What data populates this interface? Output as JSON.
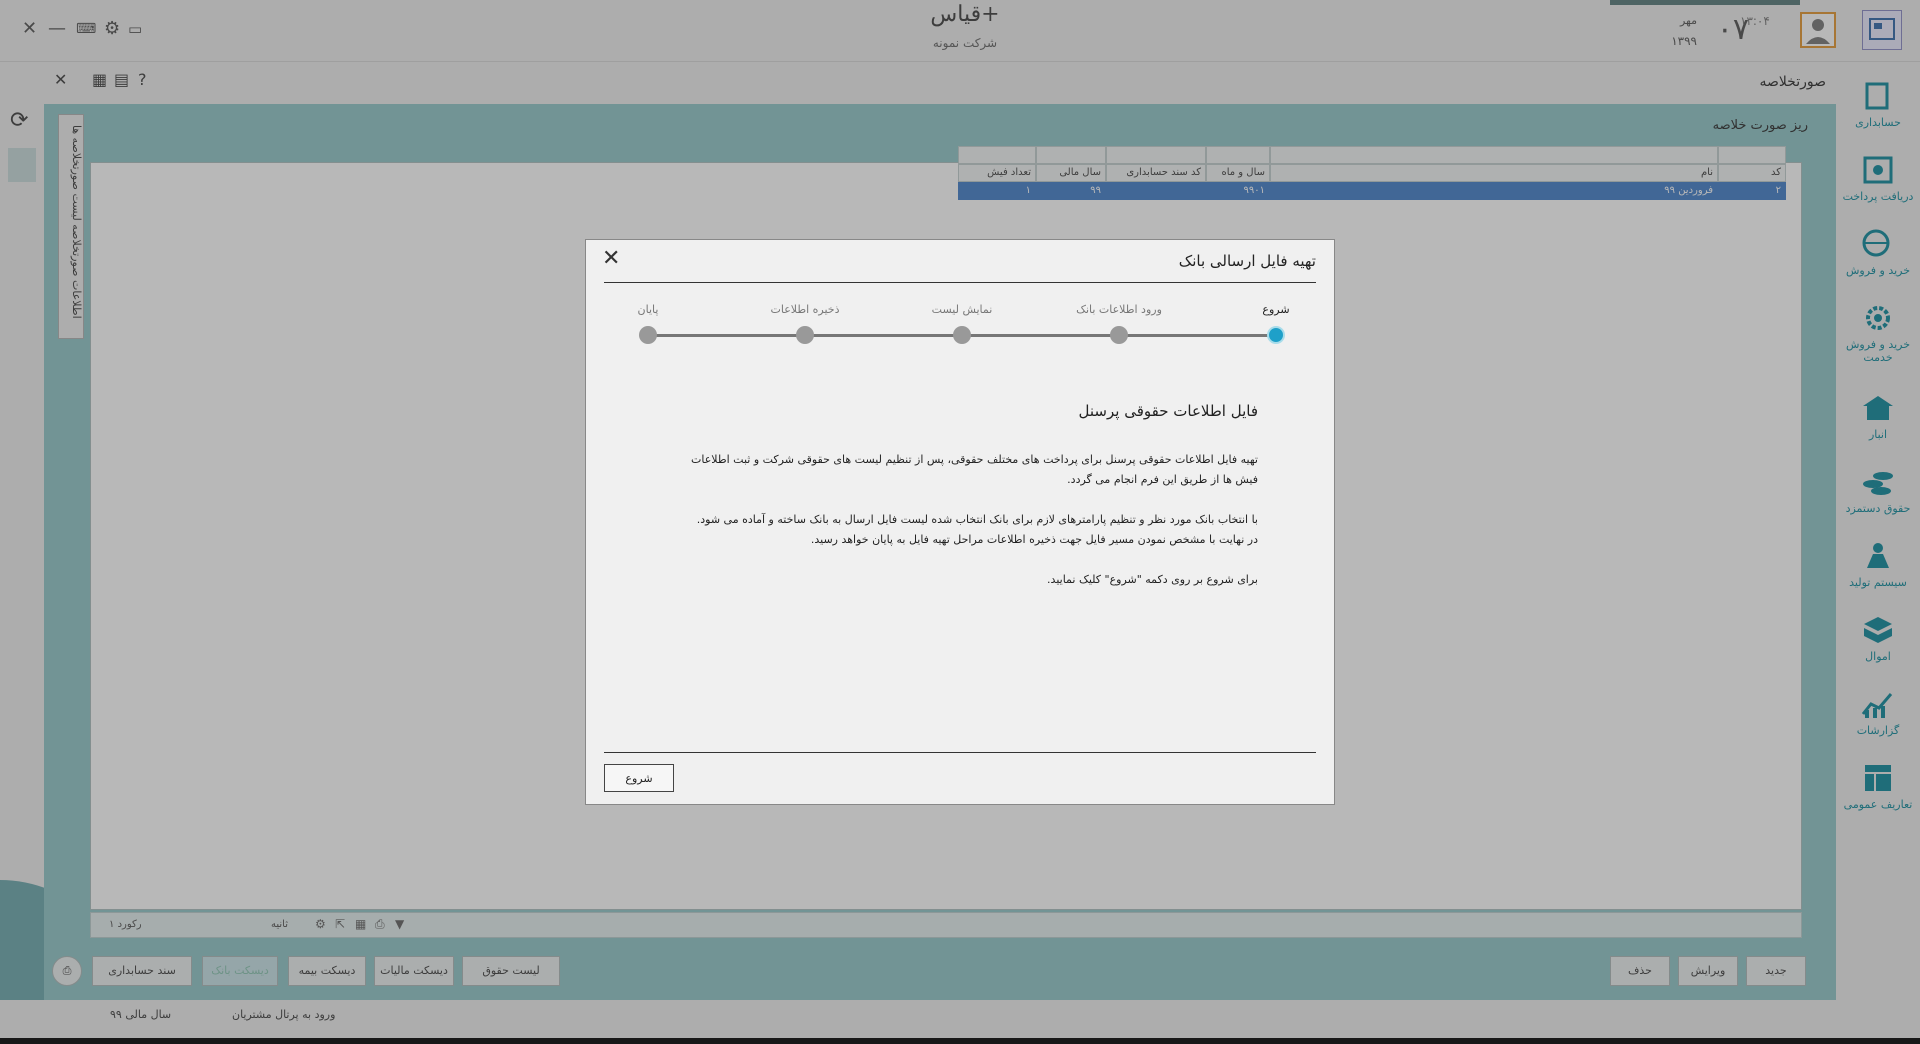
{
  "app": {
    "name": "قیاس+",
    "company": "شرکت نمونه"
  },
  "date": {
    "day": "۰۷",
    "month": "مهر",
    "year": "۱۳۹۹",
    "time": "۱۳:۰۴"
  },
  "form": {
    "title": "صورتخلاصه",
    "subtitle": "ریز صورت خلاصه",
    "vertical_tab": "اطلاعات صورتخلاصه   لیست صورتخلاصه ها"
  },
  "grid": {
    "headers": [
      "کد",
      "نام",
      "سال و ماه",
      "کد سند حسابداری",
      "سال مالی",
      "تعداد فیش"
    ],
    "rows": [
      [
        "۲",
        "فروردین ۹۹",
        "۹۹۰۱",
        "",
        "۹۹",
        "۱"
      ]
    ]
  },
  "sidebar": {
    "items": [
      {
        "label": "حسابداری",
        "icon": "accounting-icon"
      },
      {
        "label": "دریافت پرداخت",
        "icon": "cash-icon"
      },
      {
        "label": "خرید و فروش",
        "icon": "globe-cart-icon"
      },
      {
        "label": "خرید و فروش خدمت",
        "icon": "service-gear-icon"
      },
      {
        "label": "انبار",
        "icon": "warehouse-icon"
      },
      {
        "label": "حقوق دستمزد",
        "icon": "coins-icon"
      },
      {
        "label": "سیستم تولید",
        "icon": "production-icon"
      },
      {
        "label": "اموال",
        "icon": "assets-box-icon"
      },
      {
        "label": "گزارشات",
        "icon": "chart-report-icon"
      },
      {
        "label": "تعاریف عمومی",
        "icon": "definitions-table-icon"
      }
    ]
  },
  "statusbar": {
    "records": "۱ رکورد",
    "page": "ثانیه"
  },
  "bottom_buttons": {
    "new": "جدید",
    "edit": "ویرایش",
    "delete": "حذف",
    "salary_list": "لیست حقوق",
    "tax_disk": "دیسکت مالیات",
    "insurance_disk": "دیسکت بیمه",
    "bank_file": "دیسکت بانک",
    "accounting_doc": "سند حسابداری"
  },
  "footer": {
    "fiscal_year": "سال مالی ۹۹",
    "portal": "ورود به پرتال مشتریان"
  },
  "dialog": {
    "title": "تهیه فایل ارسالی بانک",
    "steps": [
      {
        "label": "شروع",
        "active": true
      },
      {
        "label": "ورود اطلاعات بانک",
        "active": false
      },
      {
        "label": "نمایش لیست",
        "active": false
      },
      {
        "label": "ذخیره اطلاعات",
        "active": false
      },
      {
        "label": "پایان",
        "active": false
      }
    ],
    "heading": "فایل اطلاعات حقوقی پرسنل",
    "p1": "تهیه فایل اطلاعات حقوقی پرسنل برای پرداخت های مختلف حقوقی، پس از تنظیم لیست های حقوقی شرکت و ثبت اطلاعات فیش ها از طریق این فرم انجام می گردد.",
    "p2a": "با انتخاب بانک مورد نظر و تنظیم پارامترهای لازم برای بانک انتخاب شده لیست فایل ارسال به بانک ساخته و آماده می شود.",
    "p2b": "در نهایت با مشخص نمودن مسیر فایل جهت ذخیره اطلاعات مراحل تهیه فایل به پایان خواهد رسید.",
    "p3": "برای شروع بر روی دکمه \"شروع\" کلیک نمایید.",
    "start_label": "شروع"
  }
}
